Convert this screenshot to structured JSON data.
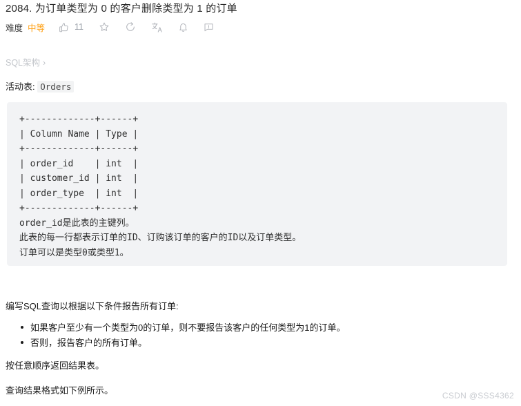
{
  "problem": {
    "title": "2084. 为订单类型为 0 的客户删除类型为 1 的订单"
  },
  "meta": {
    "difficulty_label": "难度",
    "difficulty_value": "中等",
    "difficulty_color": "#ffa116",
    "like_count": "11",
    "icons": {
      "like": "thumbs-up-icon",
      "favorite": "star-icon",
      "share": "share-circle-icon",
      "translate": "translate-icon",
      "notify": "bell-icon",
      "feedback": "comment-icon"
    }
  },
  "breadcrumb": {
    "label": "SQL架构",
    "separator": "›"
  },
  "active_table": {
    "label": "活动表:",
    "name": "Orders"
  },
  "schema_block": {
    "lines": [
      "+-------------+------+",
      "| Column Name | Type |",
      "+-------------+------+",
      "| order_id    | int  |",
      "| customer_id | int  |",
      "| order_type  | int  |",
      "+-------------+------+",
      "order_id是此表的主键列。",
      "此表的每一行都表示订单的ID、订购该订单的客户的ID以及订单类型。",
      "订单可以是类型0或类型1。"
    ],
    "text": "+-------------+------+\n| Column Name | Type |\n+-------------+------+\n| order_id    | int  |\n| customer_id | int  |\n| order_type  | int  |\n+-------------+------+\norder_id是此表的主键列。\n此表的每一行都表示订单的ID、订购该订单的客户的ID以及订单类型。\n订单可以是类型0或类型1。"
  },
  "description": {
    "prompt": "编写SQL查询以根据以下条件报告所有订单:",
    "conditions": [
      "如果客户至少有一个类型为0的订单，则不要报告该客户的任何类型为1的订单。",
      "否则，报告客户的所有订单。"
    ],
    "order_note": "按任意顺序返回结果表。",
    "format_note": "查询结果格式如下例所示。"
  },
  "watermark": {
    "text": "CSDN @SSS4362"
  }
}
